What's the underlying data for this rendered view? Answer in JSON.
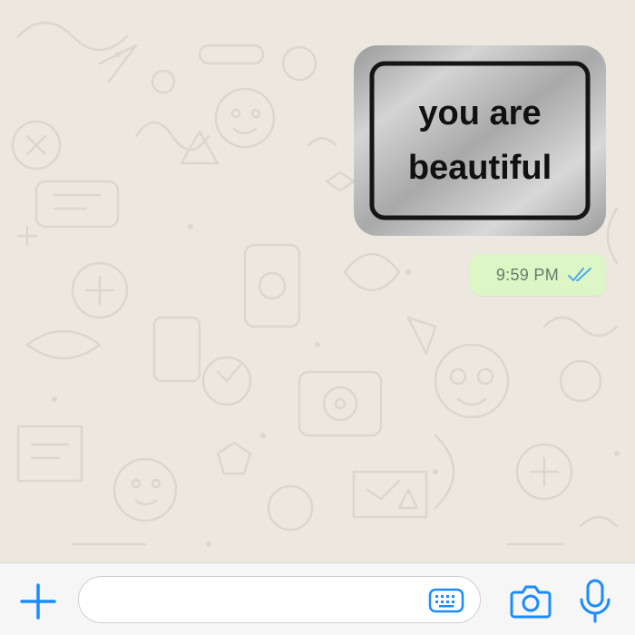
{
  "chat": {
    "sticker": {
      "line1": "you are",
      "line2": "beautiful"
    },
    "message": {
      "time": "9:59 PM",
      "status_icon": "double-check-read-icon"
    }
  },
  "composer": {
    "input_value": "",
    "input_placeholder": "",
    "icons": {
      "attach": "plus-icon",
      "keyboard": "sticker-keyboard-icon",
      "camera": "camera-icon",
      "voice": "microphone-icon"
    }
  },
  "colors": {
    "accent": "#1a8cff",
    "outgoing_bubble": "#dcf7c5",
    "wallpaper": "#ece8e0",
    "read_ticks": "#53a8f0"
  }
}
